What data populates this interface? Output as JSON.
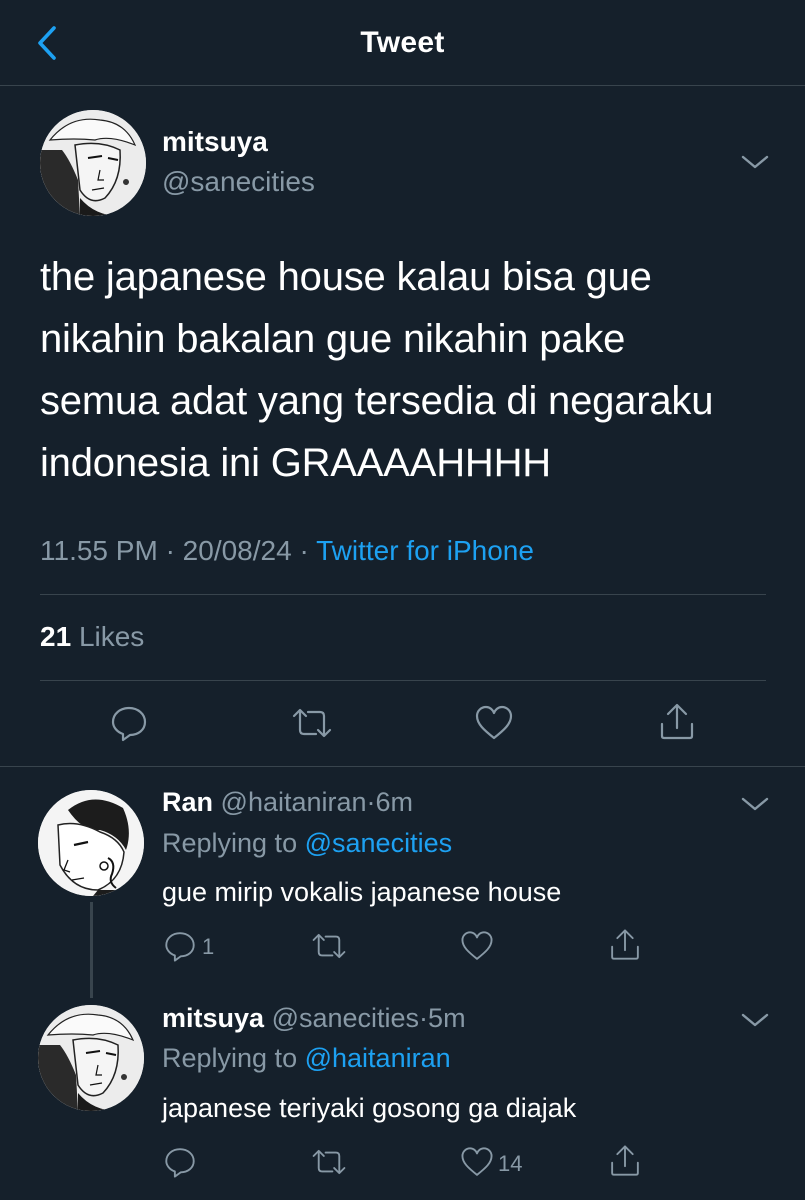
{
  "header": {
    "title": "Tweet"
  },
  "tweet": {
    "author_name": "mitsuya",
    "author_handle": "@sanecities",
    "text_lines": [
      "the japanese house kalau bisa gue",
      "nikahin bakalan gue nikahin pake",
      "semua adat yang tersedia di negaraku",
      "indonesia ini GRAAAAHHHH"
    ],
    "time": "11.55 PM",
    "separator": "·",
    "date": "20/08/24",
    "source": "Twitter for iPhone",
    "likes_count": "21",
    "likes_label": "Likes"
  },
  "replies": [
    {
      "name": "Ran",
      "handle": "@haitaniran",
      "dot": "·",
      "time": "6m",
      "replying_to_label": "Replying to",
      "replying_to": "@sanecities",
      "text": "gue mirip vokalis japanese house",
      "reply_count": "1",
      "like_count": ""
    },
    {
      "name": "mitsuya",
      "handle": "@sanecities",
      "dot": "·",
      "time": "5m",
      "replying_to_label": "Replying to",
      "replying_to": "@haitaniran",
      "text": "japanese teriyaki gosong ga diajak",
      "reply_count": "",
      "like_count": "14"
    }
  ],
  "colors": {
    "background": "#15202b",
    "text": "#ffffff",
    "muted": "#8899a6",
    "accent": "#1da1f2",
    "divider": "#38444d"
  },
  "icons": [
    "back-chevron-icon",
    "chevron-down-icon",
    "reply-icon",
    "retweet-icon",
    "like-icon",
    "share-icon"
  ]
}
